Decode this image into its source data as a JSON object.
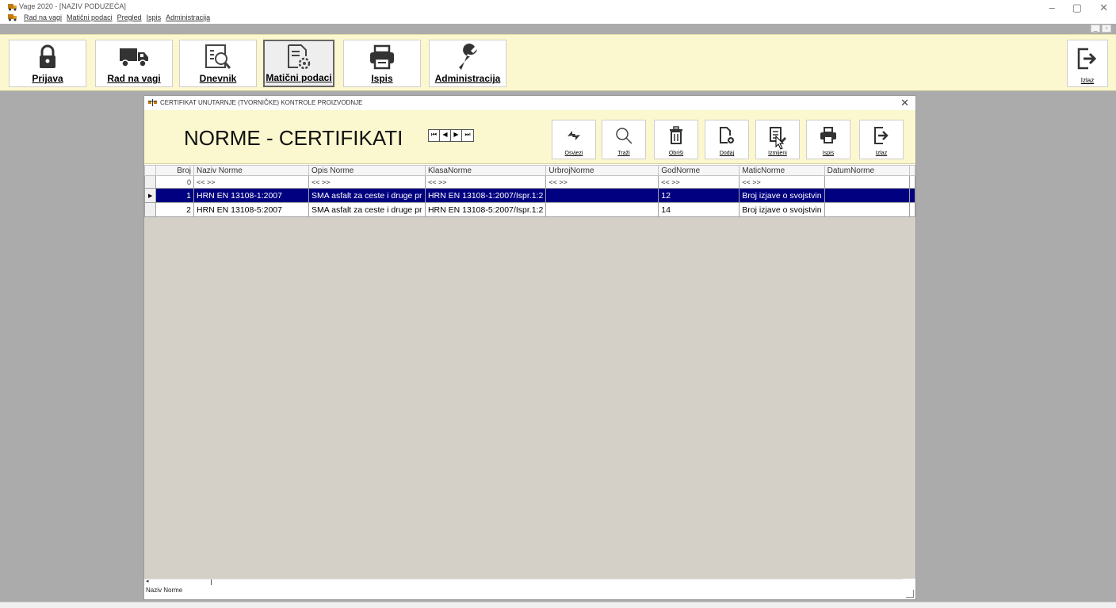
{
  "window": {
    "title": "Vage 2020 - [NAZIV PODUZEĆA]"
  },
  "menu": [
    "Rad na vagi",
    "Matični podaci",
    "Pregled",
    "Ispis",
    "Administracija"
  ],
  "toolbar": {
    "buttons": [
      "Prijava",
      "Rad na vagi",
      "Dnevnik",
      "Matični podaci",
      "Ispis",
      "Administracija"
    ],
    "exit": "Izlaz"
  },
  "child": {
    "title": "CERTIFIKAT UNUTARNJE (TVORNIČKE) KONTROLE PROIZVODNJE",
    "heading": "NORME - CERTIFIKATI",
    "actions": [
      "Osvjezi",
      "Traži",
      "Obriši",
      "Dodaj",
      "Izmijeni",
      "Ispis",
      "Izlaz"
    ]
  },
  "grid": {
    "columns": [
      "Broj",
      "Naziv Norme",
      "Opis Norme",
      "KlasaNorme",
      "UrbrojNorme",
      "GodNorme",
      "MaticNorme",
      "DatumNorme"
    ],
    "filter": [
      "0",
      "<< >>",
      "<< >>",
      "<< >>",
      "<< >>",
      "<< >>",
      "<< >>",
      ""
    ],
    "rows": [
      [
        "1",
        "HRN EN 13108-1:2007",
        "SMA asfalt za ceste i druge pr",
        "HRN EN 13108-1:2007/Ispr.1:2",
        "",
        "12",
        "Broj izjave o svojstvin",
        ""
      ],
      [
        "2",
        "HRN EN 13108-5:2007",
        "SMA asfalt za ceste i druge pr",
        "HRN EN 13108-5:2007/Ispr.1:2",
        "",
        "14",
        "Broj izjave o svojstvin",
        ""
      ]
    ],
    "status_field": "Naziv Norme"
  }
}
